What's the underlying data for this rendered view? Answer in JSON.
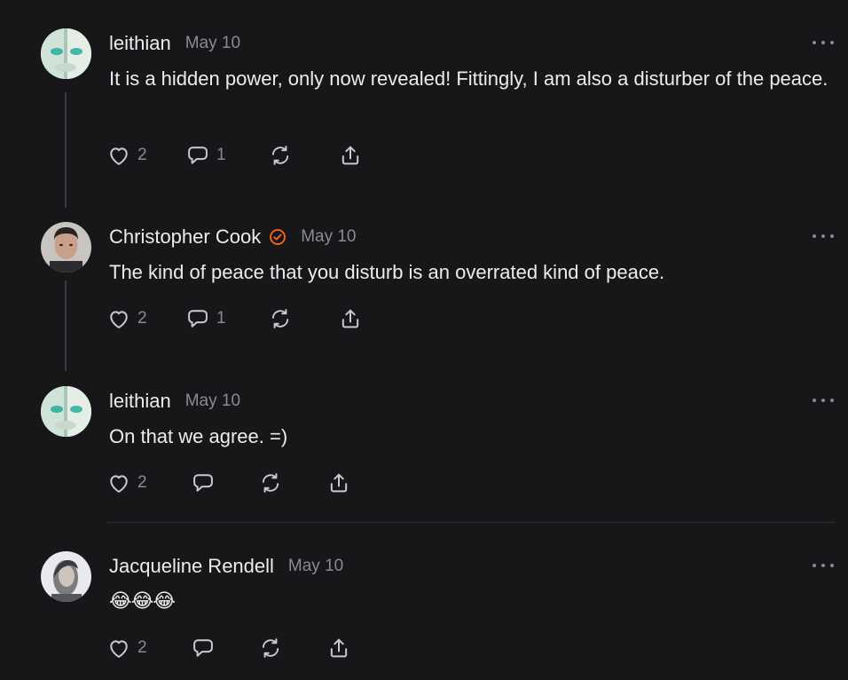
{
  "colors": {
    "background": "#17171a",
    "text": "#ececee",
    "muted": "#8a8a90",
    "verified": "#ff6719",
    "thread_line": "#3a3a3e"
  },
  "comments": [
    {
      "author": "leithian",
      "date": "May 10",
      "body": "It is a hidden power, only now revealed! Fittingly, I am also a disturber of the peace.",
      "likes": "2",
      "replies": "1",
      "verified": false,
      "avatar": "teal-face-avatar"
    },
    {
      "author": "Christopher Cook",
      "date": "May 10",
      "body": "The kind of peace that you disturb is an overrated kind of peace.",
      "likes": "2",
      "replies": "1",
      "verified": true,
      "avatar": "man-portrait-avatar"
    },
    {
      "author": "leithian",
      "date": "May 10",
      "body": "On that we agree. =)",
      "likes": "2",
      "replies": "",
      "verified": false,
      "avatar": "teal-face-avatar"
    },
    {
      "author": "Jacqueline Rendell",
      "date": "May 10",
      "body": "😂😂😂",
      "likes": "2",
      "replies": "",
      "verified": false,
      "avatar": "woman-portrait-avatar"
    }
  ]
}
